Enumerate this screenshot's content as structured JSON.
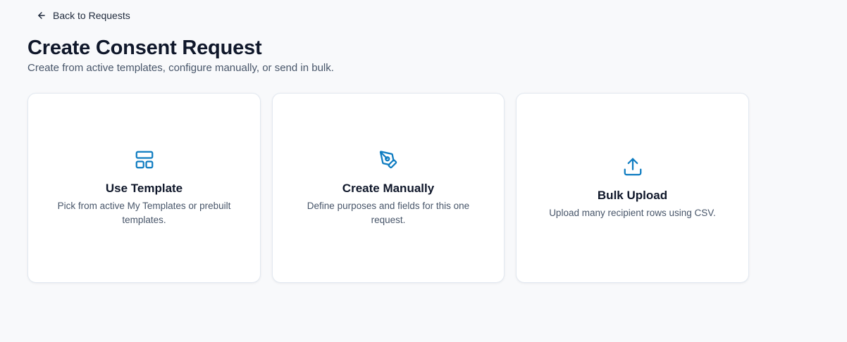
{
  "back_link": {
    "label": "Back to Requests",
    "icon": "arrow-left-icon"
  },
  "header": {
    "title": "Create Consent Request",
    "subtitle": "Create from active templates, configure manually, or send in bulk."
  },
  "cards": [
    {
      "title": "Use Template",
      "description": "Pick from active My Templates or prebuilt templates.",
      "icon": "layout-template-icon"
    },
    {
      "title": "Create Manually",
      "description": "Define purposes and fields for this one request.",
      "icon": "pen-tool-icon"
    },
    {
      "title": "Bulk Upload",
      "description": "Upload many recipient rows using CSV.",
      "icon": "upload-icon"
    }
  ],
  "colors": {
    "accent": "#0e7cc1",
    "background": "#f8f9fb",
    "card_border": "#e2e8f0",
    "title": "#0f172a",
    "muted_text": "#475569"
  }
}
